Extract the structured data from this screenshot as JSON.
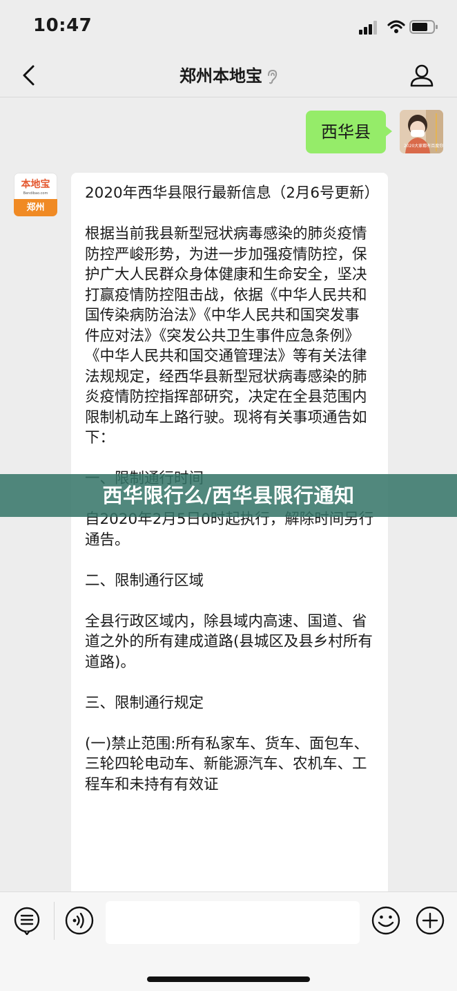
{
  "status": {
    "time": "10:47"
  },
  "nav": {
    "title": "郑州本地宝"
  },
  "messages": {
    "outgoing_text": "西华县",
    "user_avatar_watermark": "2020大家都有百度你好",
    "bot_avatar": {
      "top": "本地宝",
      "url": "Bendibao.com",
      "bottom": "郑州"
    },
    "incoming_paragraphs": [
      "2020年西华县限行最新信息（2月6号更新）",
      "根据当前我县新型冠状病毒感染的肺炎疫情防控严峻形势，为进一步加强疫情防控，保护广大人民群众身体健康和生命安全，坚决打赢疫情防控阻击战，依据《中华人民共和国传染病防治法》《中华人民共和国突发事件应对法》《突发公共卫生事件应急条例》《中华人民共和国交通管理法》等有关法律法规规定，经西华县新型冠状病毒感染的肺炎疫情防控指挥部研究，决定在全县范围内限制机动车上路行驶。现将有关事项通告如下：",
      "一、限制通行时间",
      "自2020年2月5日0时起执行，解除时间另行通告。",
      "二、限制通行区域",
      "全县行政区域内，除县域内高速、国道、省道之外的所有建成道路(县城区及县乡村所有道路)。",
      "三、限制通行规定",
      "(一)禁止范围:所有私家车、货车、面包车、三轮四轮电动车、新能源汽车、农机车、工程车和未持有有效证"
    ]
  },
  "banner": {
    "text": "西华限行么/西华县限行通知"
  },
  "input": {
    "placeholder": ""
  }
}
